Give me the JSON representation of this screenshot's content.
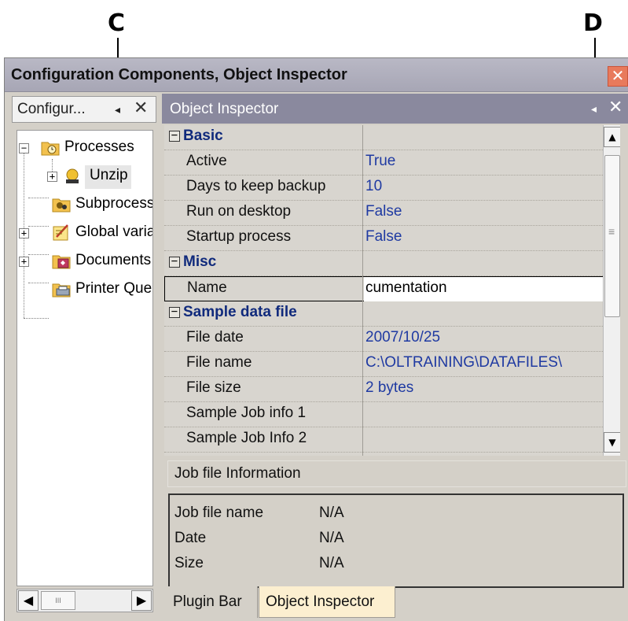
{
  "callouts": {
    "c": "C",
    "d": "D"
  },
  "window": {
    "title": "Configuration Components, Object Inspector",
    "close_glyph": "✕"
  },
  "left_panel": {
    "header_label": "Configur...",
    "arrow_glyph": "◂",
    "close_glyph": "✕",
    "tree": [
      {
        "label": "Processes",
        "icon": "processes-icon",
        "expander": "−"
      },
      {
        "label": "Unzip",
        "icon": "process-icon",
        "expander": "+"
      },
      {
        "label": "Subprocesses",
        "icon": "subprocesses-icon",
        "expander": ""
      },
      {
        "label": "Global variables",
        "icon": "global-variables-icon",
        "expander": "+"
      },
      {
        "label": "Documents",
        "icon": "documents-icon",
        "expander": "+"
      },
      {
        "label": "Printer Queues",
        "icon": "printer-queues-icon",
        "expander": ""
      }
    ],
    "scroll_left": "◀",
    "scroll_right": "▶",
    "thumb_grip": "III"
  },
  "object_inspector": {
    "title": "Object Inspector",
    "arrow_glyph": "◂",
    "close_glyph": "✕",
    "rows": [
      {
        "kind": "category",
        "toggle": "−",
        "name": "Basic",
        "value": ""
      },
      {
        "kind": "prop",
        "name": "Active",
        "value": "True"
      },
      {
        "kind": "prop",
        "name": "Days to keep backup",
        "value": "10"
      },
      {
        "kind": "prop",
        "name": "Run on desktop",
        "value": "False"
      },
      {
        "kind": "prop",
        "name": "Startup process",
        "value": "False"
      },
      {
        "kind": "category",
        "toggle": "−",
        "name": "Misc",
        "value": ""
      },
      {
        "kind": "edit",
        "name": "Name",
        "value": "cumentation"
      },
      {
        "kind": "category",
        "toggle": "−",
        "name": "Sample data file",
        "value": ""
      },
      {
        "kind": "prop",
        "name": "File date",
        "value": "2007/10/25"
      },
      {
        "kind": "prop",
        "name": "File name",
        "value": "C:\\OLTRAINING\\DATAFILES\\"
      },
      {
        "kind": "prop",
        "name": "File size",
        "value": "2 bytes"
      },
      {
        "kind": "prop",
        "name": "Sample Job info 1",
        "value": ""
      },
      {
        "kind": "prop",
        "name": "Sample Job Info 2",
        "value": ""
      }
    ],
    "scroll_up": "▲",
    "scroll_down": "▼",
    "scroll_grip": "≡"
  },
  "job_info": {
    "title": "Job file Information",
    "rows": [
      {
        "label": "Job file name",
        "value": "N/A"
      },
      {
        "label": "Date",
        "value": "N/A"
      },
      {
        "label": "Size",
        "value": "N/A"
      }
    ]
  },
  "tabs": [
    {
      "label": "Plugin Bar",
      "active": false
    },
    {
      "label": "Object Inspector",
      "active": true
    }
  ],
  "colors": {
    "accent_header": "#8a899e",
    "category_text": "#102a7c",
    "value_text": "#1f3aa2",
    "active_tab": "#fcefd0"
  }
}
